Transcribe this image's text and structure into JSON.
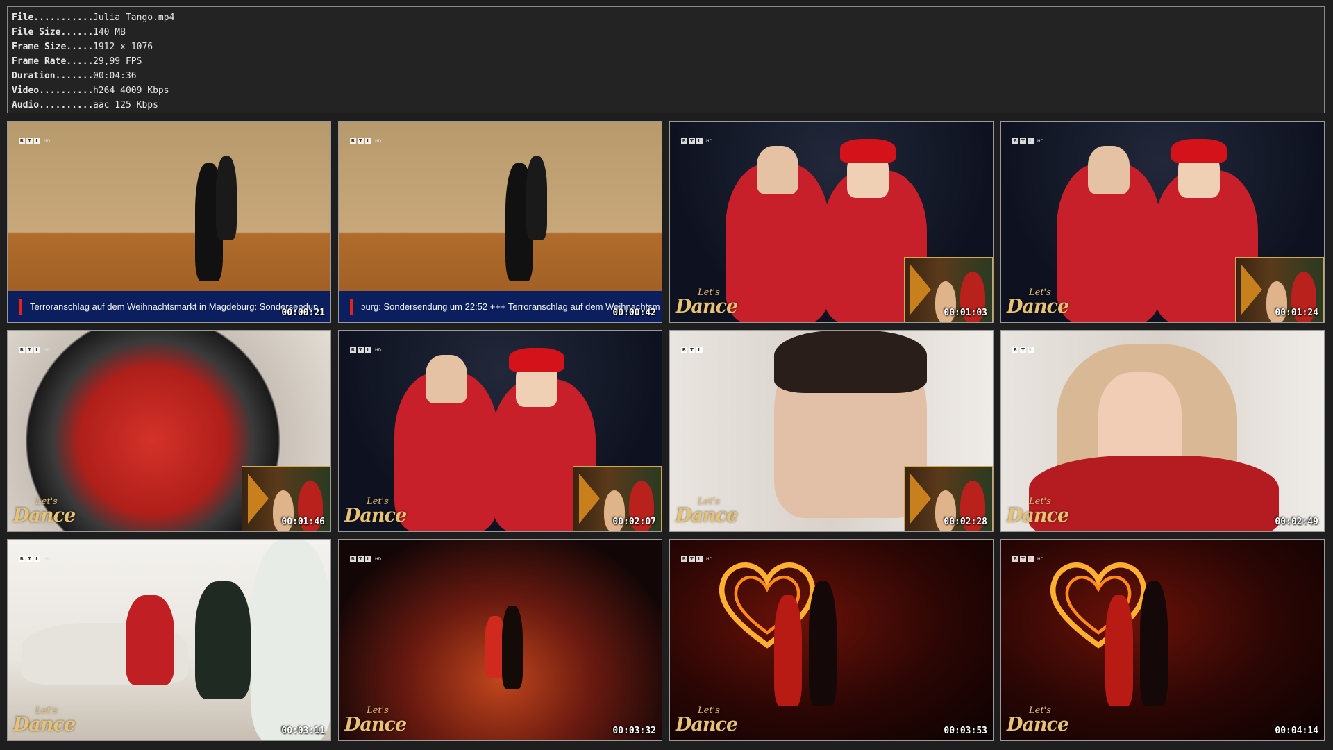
{
  "info": {
    "rows": [
      {
        "key": "File...........",
        "value": "Julia Tango.mp4"
      },
      {
        "key": "File Size......",
        "value": "140 MB"
      },
      {
        "key": "Frame Size.....",
        "value": "1912 x 1076"
      },
      {
        "key": "Frame Rate.....",
        "value": "29,99 FPS"
      },
      {
        "key": "Duration.......",
        "value": "00:04:36"
      },
      {
        "key": "Video..........",
        "value": "h264 4009 Kbps"
      },
      {
        "key": "Audio..........",
        "value": "aac 125 Kbps"
      }
    ]
  },
  "channel_logo": {
    "letters": [
      "R",
      "T",
      "L"
    ],
    "suffix": "HD"
  },
  "show_logo": {
    "line1": "Let's",
    "line2": "Dance"
  },
  "thumbnails": [
    {
      "timestamp": "00:00:21",
      "scene": "studio-dance",
      "ticker": "Terroranschlag auf dem Weihnachtsmarkt in Magdeburg: Sondersendun"
    },
    {
      "timestamp": "00:00:42",
      "scene": "studio-dance",
      "ticker": "ɔurg: Sondersendung um 22:52 +++ Terroranschlag auf dem Weihnachtsm"
    },
    {
      "timestamp": "00:01:03",
      "scene": "christmas-couple"
    },
    {
      "timestamp": "00:01:24",
      "scene": "christmas-couple"
    },
    {
      "timestamp": "00:01:46",
      "scene": "red-bowl"
    },
    {
      "timestamp": "00:02:07",
      "scene": "christmas-couple"
    },
    {
      "timestamp": "00:02:28",
      "scene": "closeup-man"
    },
    {
      "timestamp": "00:02:49",
      "scene": "closeup-woman"
    },
    {
      "timestamp": "00:03:11",
      "scene": "living-room"
    },
    {
      "timestamp": "00:03:32",
      "scene": "stage-dance"
    },
    {
      "timestamp": "00:03:53",
      "scene": "fire-heart"
    },
    {
      "timestamp": "00:04:14",
      "scene": "fire-heart"
    }
  ],
  "colors": {
    "background": "#1e1e1e",
    "panel_border": "#8a8a8a",
    "ticker_bg": "#0b1f5e",
    "ticker_accent": "#e2231a",
    "logo_gold": "#e7c174"
  }
}
